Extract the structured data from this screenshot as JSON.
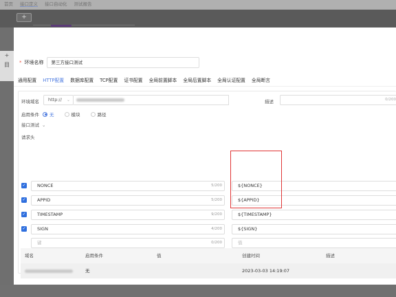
{
  "background": {
    "tabs": [
      "首页",
      "接口定义",
      "接口自动化",
      "测试报告"
    ],
    "add_label": "+",
    "add_label2": "+",
    "left_label": "目"
  },
  "form": {
    "env_name_label": "环境名称",
    "env_name_value": "第三方接口测试"
  },
  "tabs": [
    {
      "label": "通用配置",
      "active": false
    },
    {
      "label": "HTTP配置",
      "active": true
    },
    {
      "label": "数据库配置",
      "active": false
    },
    {
      "label": "TCP配置",
      "active": false
    },
    {
      "label": "证书配置",
      "active": false
    },
    {
      "label": "全局前置脚本",
      "active": false
    },
    {
      "label": "全局后置脚本",
      "active": false
    },
    {
      "label": "全局认证配置",
      "active": false
    },
    {
      "label": "全局断言",
      "active": false
    }
  ],
  "http": {
    "domain_label": "环境域名",
    "protocol": "http://",
    "description_label": "描述",
    "description_counter": "0/200",
    "condition_label": "启用条件",
    "condition_options": [
      {
        "label": "无",
        "selected": true
      },
      {
        "label": "模块",
        "selected": false
      },
      {
        "label": "路径",
        "selected": false
      }
    ],
    "module_label": "接口测试",
    "headers_label": "请求头",
    "headers": [
      {
        "key": "NONCE",
        "count": "5/200",
        "value": "${NONCE}",
        "checked": true
      },
      {
        "key": "APPID",
        "count": "5/200",
        "value": "${APPID}",
        "checked": true
      },
      {
        "key": "TIMESTAMP",
        "count": "9/200",
        "value": "${TIMESTAMP}",
        "checked": true
      },
      {
        "key": "SIGN",
        "count": "4/200",
        "value": "${SIGN}",
        "checked": true
      }
    ],
    "empty_row": {
      "key_placeholder": "键",
      "count": "0/200",
      "value_placeholder": "值"
    }
  },
  "table": {
    "columns": [
      "域名",
      "启用条件",
      "值",
      "创建时间",
      "描述"
    ],
    "rows": [
      {
        "condition": "无",
        "value": "",
        "created": "2023-03-03 14:19:07",
        "description": ""
      }
    ]
  },
  "colors": {
    "accent": "#4d7be0",
    "checkbox": "#2f6fde",
    "highlight": "#e03434"
  }
}
